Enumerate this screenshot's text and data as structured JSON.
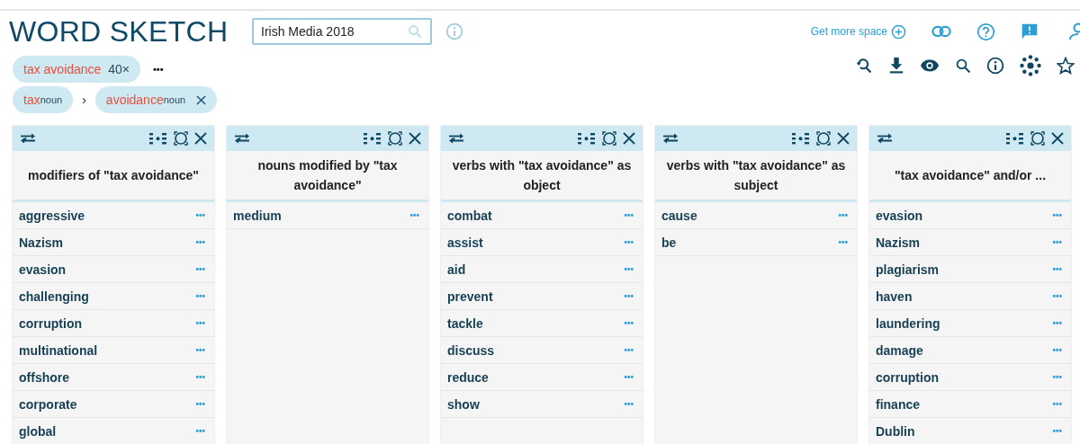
{
  "title": "WORD SKETCH",
  "corpus_field": {
    "value": "Irish Media 2018"
  },
  "top_links": {
    "more_space": "Get more space"
  },
  "query_chip": {
    "term": "tax avoidance",
    "count": "40×"
  },
  "more": "•••",
  "path": [
    {
      "word": "tax",
      "pos": "noun",
      "removable": false
    },
    {
      "word": "avoidance",
      "pos": "noun",
      "removable": true
    }
  ],
  "path_separator": "›",
  "columns": [
    {
      "title": "modifiers of \"tax avoidance\"",
      "rows": [
        "aggressive",
        "Nazism",
        "evasion",
        "challenging",
        "corruption",
        "multinational",
        "offshore",
        "corporate",
        "global"
      ]
    },
    {
      "title": "nouns modified by \"tax avoidance\"",
      "rows": [
        "medium"
      ]
    },
    {
      "title": "verbs with \"tax avoidance\" as object",
      "rows": [
        "combat",
        "assist",
        "aid",
        "prevent",
        "tackle",
        "discuss",
        "reduce",
        "show"
      ]
    },
    {
      "title": "verbs with \"tax avoidance\" as subject",
      "rows": [
        "cause",
        "be"
      ]
    },
    {
      "title": "\"tax avoidance\" and/or ...",
      "rows": [
        "evasion",
        "Nazism",
        "plagiarism",
        "haven",
        "laundering",
        "damage",
        "corruption",
        "finance",
        "Dublin"
      ]
    }
  ]
}
